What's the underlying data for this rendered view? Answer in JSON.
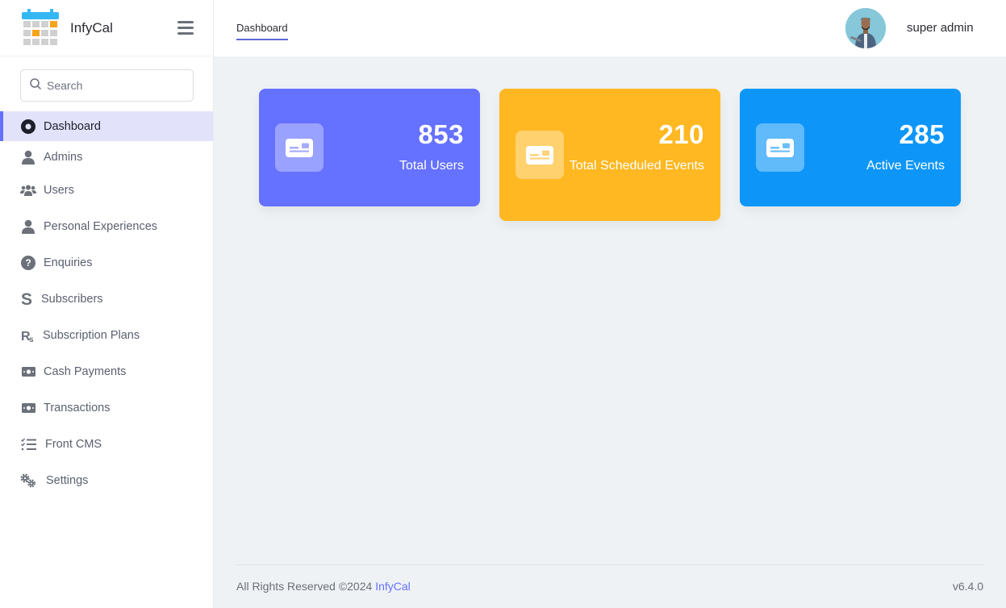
{
  "brand": {
    "name": "InfyCal"
  },
  "search": {
    "placeholder": "Search"
  },
  "sidebar": {
    "items": [
      {
        "label": "Dashboard",
        "icon": "dashboard-icon",
        "active": true
      },
      {
        "label": "Admins",
        "icon": "user-icon"
      },
      {
        "label": "Users",
        "icon": "users-icon"
      },
      {
        "label": "Personal Experiences",
        "icon": "user-icon"
      },
      {
        "label": "Enquiries",
        "icon": "question-circle-icon"
      },
      {
        "label": "Subscribers",
        "icon": "s-letter-icon"
      },
      {
        "label": "Subscription Plans",
        "icon": "rupee-icon"
      },
      {
        "label": "Cash Payments",
        "icon": "money-bill-icon"
      },
      {
        "label": "Transactions",
        "icon": "money-bill-icon"
      },
      {
        "label": "Front CMS",
        "icon": "checklist-icon"
      },
      {
        "label": "Settings",
        "icon": "gears-icon"
      }
    ]
  },
  "header": {
    "tab": "Dashboard",
    "user_name": "super admin"
  },
  "cards": [
    {
      "value": "853",
      "label": "Total Users",
      "color": "#6571ff"
    },
    {
      "value": "210",
      "label": "Total Scheduled Events",
      "color": "#ffb822"
    },
    {
      "value": "285",
      "label": "Active Events",
      "color": "#0d96f8"
    }
  ],
  "footer": {
    "copyright": "All Rights Reserved ©2024",
    "link": "InfyCal",
    "version": "v6.4.0"
  }
}
